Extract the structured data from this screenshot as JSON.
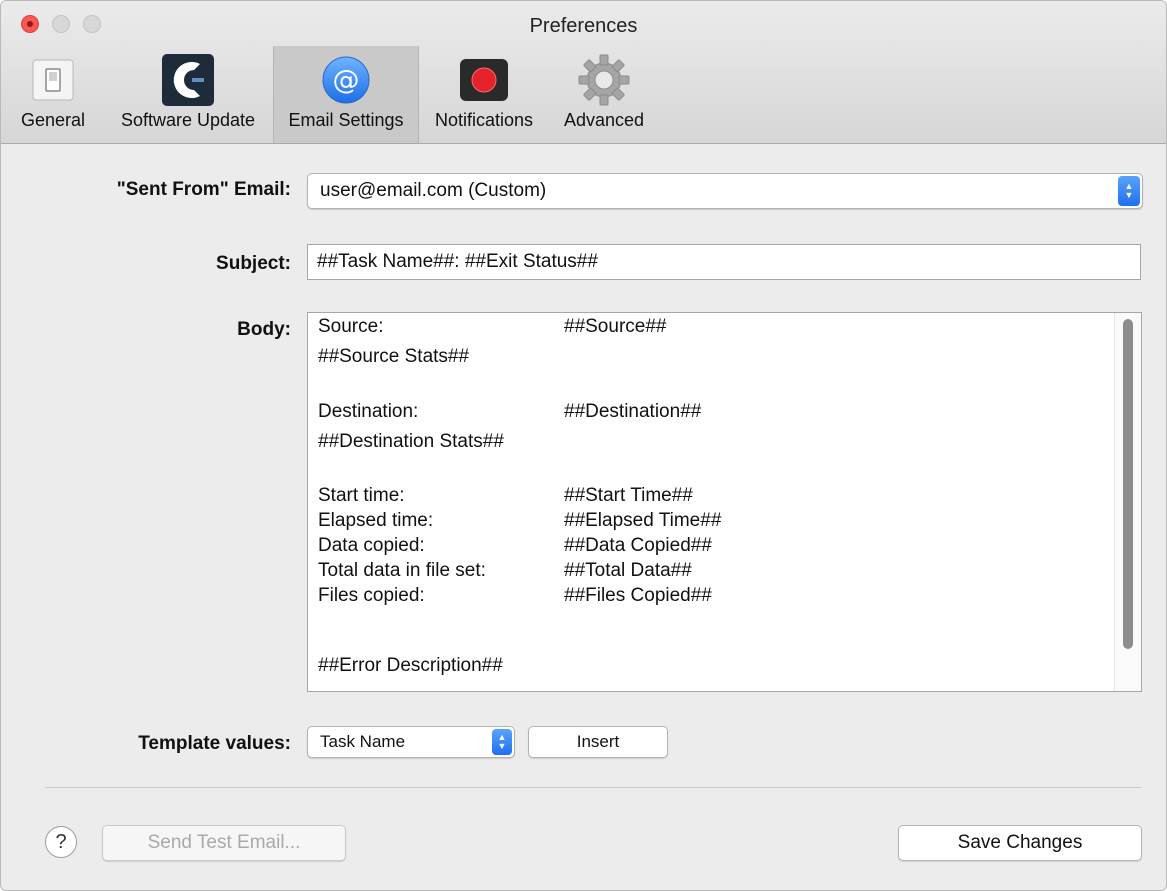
{
  "window": {
    "title": "Preferences"
  },
  "tabs": [
    {
      "label": "General",
      "icon": "switch-icon"
    },
    {
      "label": "Software Update",
      "icon": "app-logo-icon"
    },
    {
      "label": "Email Settings",
      "icon": "at-sign-icon",
      "glyph": "@"
    },
    {
      "label": "Notifications",
      "icon": "record-icon"
    },
    {
      "label": "Advanced",
      "icon": "gear-icon"
    }
  ],
  "form": {
    "sent_from_label": "\"Sent From\" Email:",
    "sent_from_value": "user@email.com (Custom)",
    "subject_label": "Subject:",
    "subject_value": "##Task Name##: ##Exit Status##",
    "body_label": "Body:",
    "body_lines": [
      {
        "k": "Source:",
        "v": "##Source##"
      },
      {
        "k": "##Source Stats##",
        "v": ""
      },
      {
        "k": "",
        "v": ""
      },
      {
        "k": "Destination:",
        "v": "##Destination##"
      },
      {
        "k": "##Destination Stats##",
        "v": ""
      },
      {
        "k": "",
        "v": ""
      },
      {
        "k": "Start time:",
        "v": "##Start Time##"
      },
      {
        "k": "Elapsed time:",
        "v": "##Elapsed Time##"
      },
      {
        "k": "Data copied:",
        "v": "##Data Copied##"
      },
      {
        "k": "Total data in file set:",
        "v": "##Total Data##"
      },
      {
        "k": "Files copied:",
        "v": "##Files Copied##"
      },
      {
        "k": "",
        "v": ""
      },
      {
        "k": "##Error Description##",
        "v": ""
      }
    ],
    "template_label": "Template values:",
    "template_value": "Task Name",
    "insert_label": "Insert"
  },
  "footer": {
    "help_glyph": "?",
    "send_test_label": "Send Test Email...",
    "save_label": "Save Changes"
  },
  "colors": {
    "accent": "#2b7bf5",
    "close": "#fc5753",
    "record": "#e5232b"
  }
}
